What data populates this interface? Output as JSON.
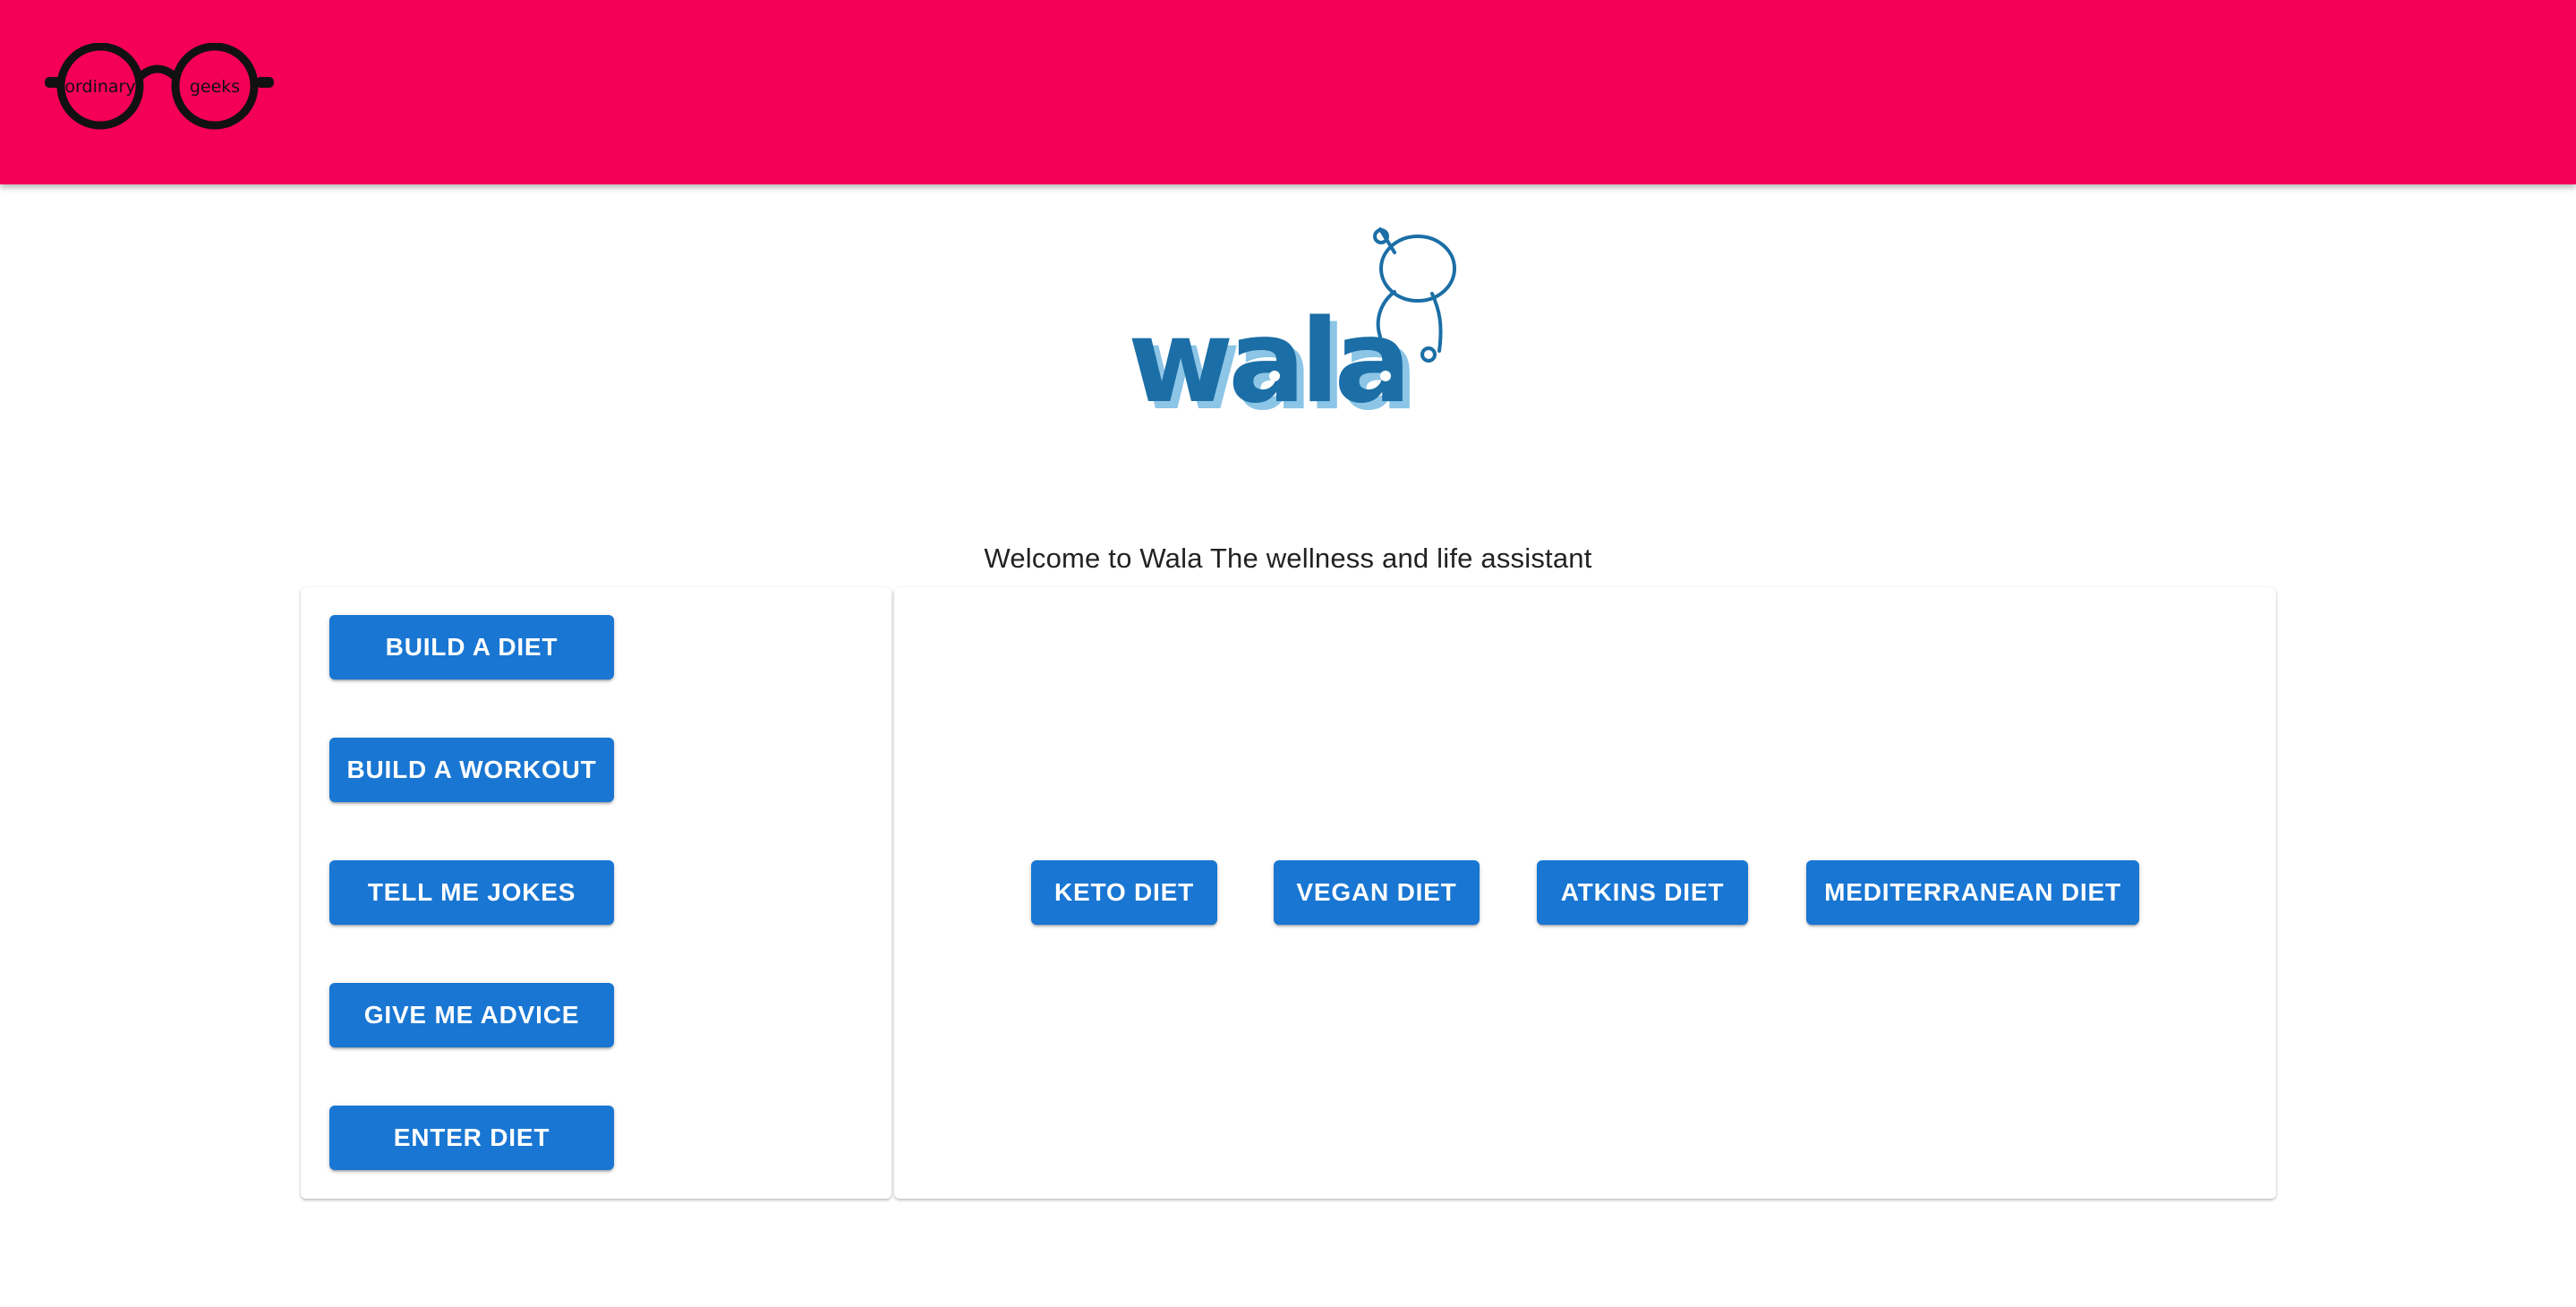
{
  "header": {
    "brand_left": "ordinary",
    "brand_right": "geeks",
    "accent_color": "#f50057"
  },
  "logo": {
    "text": "wala",
    "icon": "robot-mascot-icon",
    "color": "#1b6ea6"
  },
  "welcome_text": "Welcome to Wala The wellness and life assistant",
  "menu": {
    "items": [
      {
        "label": "BUILD A DIET"
      },
      {
        "label": "BUILD A WORKOUT"
      },
      {
        "label": "TELL ME JOKES"
      },
      {
        "label": "GIVE ME ADVICE"
      },
      {
        "label": "ENTER DIET"
      }
    ]
  },
  "diets": {
    "items": [
      {
        "label": "KETO DIET"
      },
      {
        "label": "VEGAN DIET"
      },
      {
        "label": "ATKINS DIET"
      },
      {
        "label": "MEDITERRANEAN DIET"
      }
    ]
  },
  "colors": {
    "button": "#1976d2",
    "button_text": "#ffffff"
  }
}
